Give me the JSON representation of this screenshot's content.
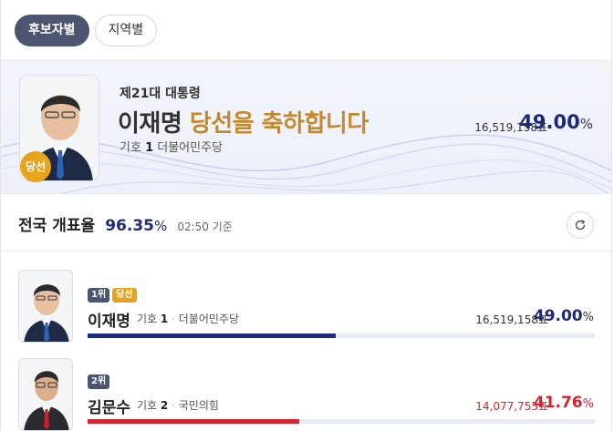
{
  "tabs": [
    {
      "label": "후보자별",
      "active": true
    },
    {
      "label": "지역별",
      "active": false
    }
  ],
  "banner": {
    "subtitle": "제21대 대통령",
    "name": "이재명",
    "message": "당선을 축하합니다",
    "symbol_label": "기호",
    "symbol_number": "1",
    "party": "더불어민주당",
    "votes": "16,519,158표",
    "percent": "49.00",
    "percent_unit": "%",
    "badge": "당선"
  },
  "count": {
    "label": "전국 개표율",
    "value": "96.35",
    "unit": "%",
    "time": "02:50 기준"
  },
  "candidates": [
    {
      "rank": "1위",
      "win_tag": "당선",
      "name": "이재명",
      "symbol_label": "기호",
      "symbol_number": "1",
      "sep": "·",
      "party": "더불어민주당",
      "votes": "16,519,158표",
      "percent": "49.00",
      "percent_unit": "%",
      "share": 0.49,
      "color": "#1e2a78"
    },
    {
      "rank": "2위",
      "name": "김문수",
      "symbol_label": "기호",
      "symbol_number": "2",
      "sep": "·",
      "party": "국민의힘",
      "votes": "14,077,755표",
      "percent": "41.76",
      "percent_unit": "%",
      "share": 0.4176,
      "color": "#d7232f"
    }
  ],
  "icons": {
    "refresh": "refresh-icon",
    "candidate_photo": "person-photo-icon"
  }
}
